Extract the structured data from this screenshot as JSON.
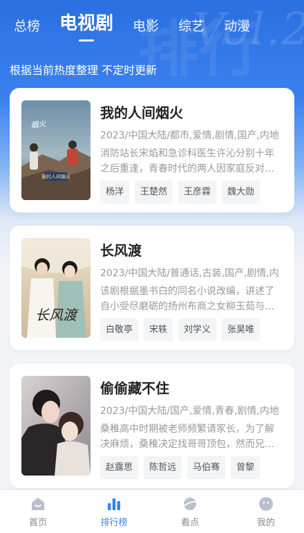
{
  "top_tabs": [
    "总榜",
    "电视剧",
    "电影",
    "综艺",
    "动漫"
  ],
  "subtitle": "根据当前热度整理 不定时更新",
  "shows": [
    {
      "title": "我的人间烟火",
      "meta": "2023/中国大陆/都市,爱情,剧情,国产,内地",
      "desc": "消防站长宋焰和急诊科医生许沁分别十年之后重逢，青春时代的两人因家庭反对…",
      "actors": [
        "杨洋",
        "王楚然",
        "王彦霖",
        "魏大勋"
      ],
      "poster_title": "我的人间烟火"
    },
    {
      "title": "长风渡",
      "meta": "2023/中国大陆/普通话,古装,国产,剧情,内",
      "desc": "该剧根据墨书白的同名小说改编，讲述了自小受尽磨砺的扬州布商之女柳玉茹与…",
      "actors": [
        "白敬亭",
        "宋轶",
        "刘学义",
        "张昊唯"
      ],
      "poster_title": "长风渡"
    },
    {
      "title": "偷偷藏不住",
      "meta": "2023/中国大陆/国产,爱情,青春,剧情,内地",
      "desc": "桑稚高中时期被老师频繁请家长，为了解决麻烦，桑稚决定找哥哥顶包，然而兄…",
      "actors": [
        "赵露思",
        "陈哲远",
        "马伯骞",
        "曾黎"
      ],
      "poster_title": ""
    }
  ],
  "bottom_nav": [
    {
      "label": "首页",
      "icon": "home-icon"
    },
    {
      "label": "排行榜",
      "icon": "chart-icon"
    },
    {
      "label": "看点",
      "icon": "planet-icon"
    },
    {
      "label": "我的",
      "icon": "face-icon"
    }
  ],
  "colors": {
    "accent": "#3b82ef",
    "hero": "#2a6fe0"
  }
}
